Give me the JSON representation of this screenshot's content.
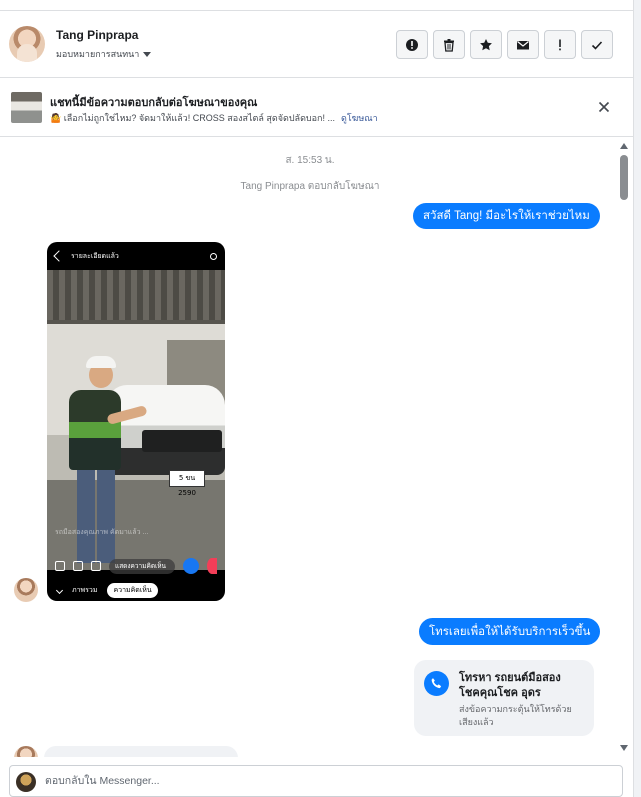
{
  "header": {
    "name": "Tang Pinprapa",
    "assign_label": "มอบหมายการสนทนา",
    "actions": [
      "spam-icon",
      "trash-icon",
      "star-icon",
      "mail-icon",
      "important-icon",
      "done-icon"
    ]
  },
  "ad_banner": {
    "title": "แชทนี้มีข้อความตอบกลับต่อโฆษณาของคุณ",
    "subtitle": "🤷 เลือกไม่ถูกใช่ไหม? จัดมาให้แล้ว! CROSS สองสไตล์ สุดจัดปลัดบอก! ...",
    "link": "ดูโฆษณา"
  },
  "thread": {
    "timestamp": "ส. 15:53 น.",
    "replied_note": "Tang Pinprapa ตอบกลับโฆษณา",
    "msg_greeting": "สวัสดี Tang! มีอะไรให้เราช่วยไหม",
    "msg_call": "โทรเลยเพื่อให้ได้รับบริการเร็วขึ้น",
    "call_card": {
      "title": "โทรหา รถยนต์มือสอง โชคคุณโชค อุดร",
      "subtitle": "ส่งข้อความกระตุ้นให้โทรด้วยเสียงแล้ว"
    },
    "video": {
      "top_label": "รายละเอียดแล้ว",
      "plate": "5 ขน 2590",
      "caption": "รถมือสองคุณภาพ คัดมาแล้ว ...",
      "comment_pill": "แสดงความคิดเห็น",
      "tabs": [
        "ภาพรวม",
        "ความคิดเห็น"
      ]
    }
  },
  "composer": {
    "placeholder": "ตอบกลับใน Messenger..."
  },
  "colors": {
    "accent": "#0a7cff",
    "bubble_in": "#f0f2f5"
  }
}
